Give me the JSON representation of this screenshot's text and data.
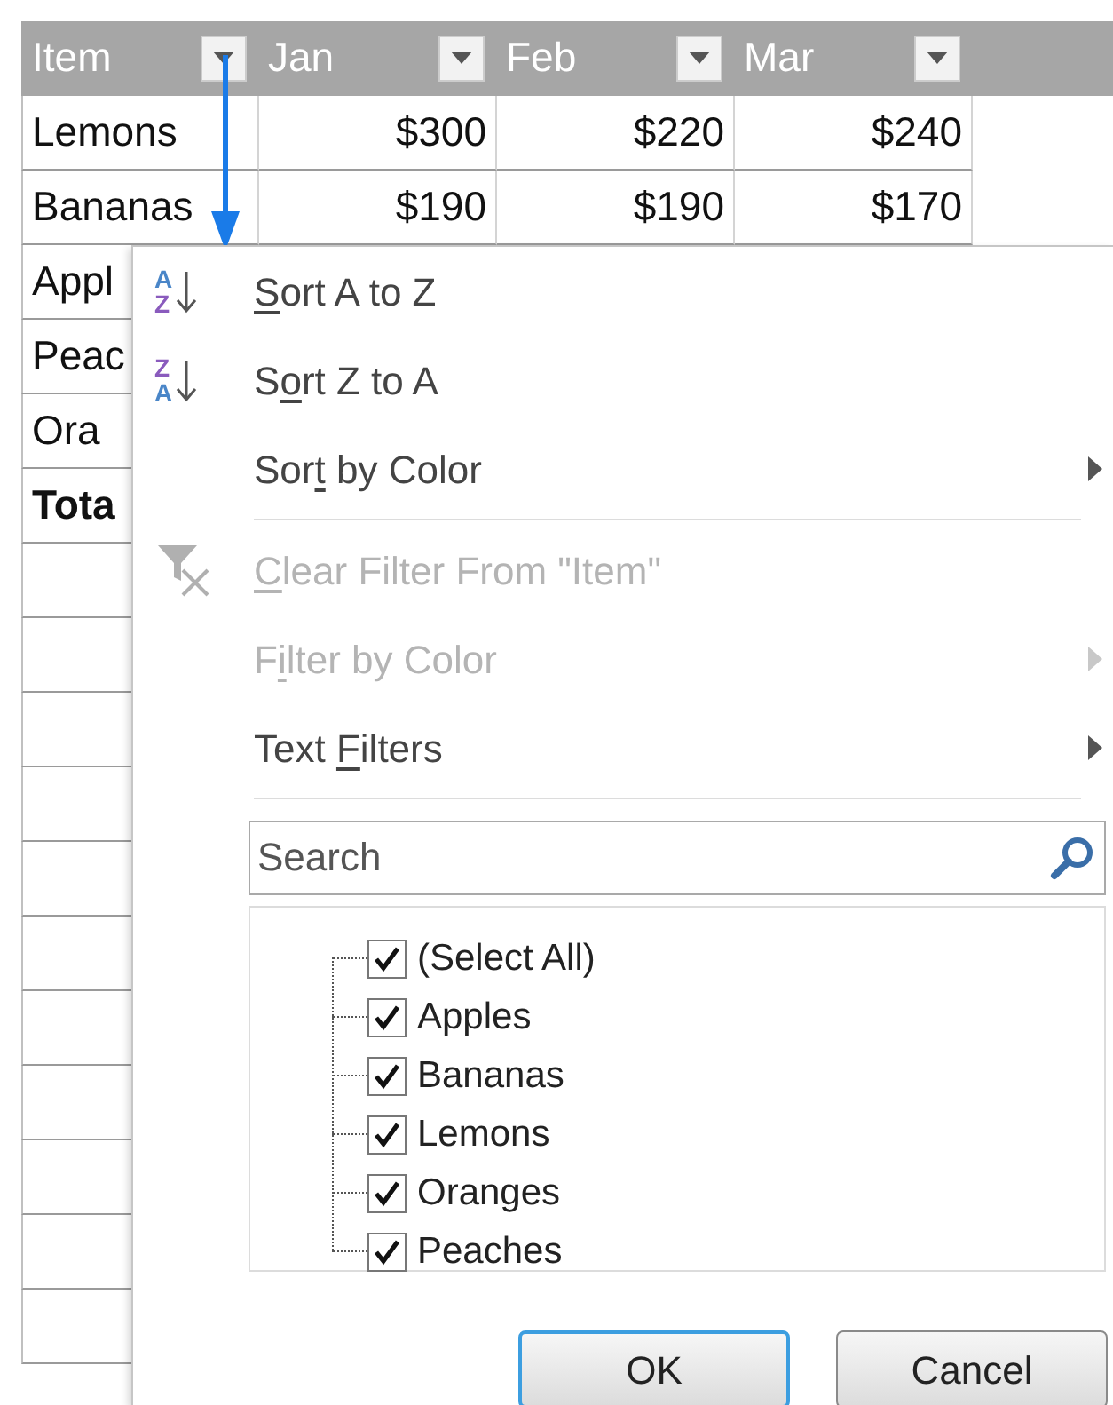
{
  "table": {
    "columns": [
      {
        "label": "Item"
      },
      {
        "label": "Jan"
      },
      {
        "label": "Feb"
      },
      {
        "label": "Mar"
      }
    ],
    "rows": [
      {
        "kind": "data",
        "cells": [
          "Lemons",
          "$300",
          "$220",
          "$240"
        ]
      },
      {
        "kind": "data",
        "cells": [
          "Bananas",
          "$190",
          "$190",
          "$170"
        ]
      },
      {
        "kind": "data",
        "cells": [
          "Appl"
        ]
      },
      {
        "kind": "data",
        "cells": [
          "Peac"
        ]
      },
      {
        "kind": "data",
        "cells": [
          "Ora"
        ]
      },
      {
        "kind": "total",
        "cells": [
          "Tota"
        ]
      }
    ]
  },
  "filter_menu": {
    "items": [
      {
        "kind": "command",
        "icon": {
          "kind": "sort",
          "top": "A",
          "bottom": "Z"
        },
        "key": "S",
        "after": "ort A to Z",
        "disabled": false,
        "submenu": false
      },
      {
        "kind": "command",
        "icon": {
          "kind": "sort",
          "top": "Z",
          "bottom": "A"
        },
        "before": "S",
        "key": "o",
        "after": "rt Z to A",
        "disabled": false,
        "submenu": false
      },
      {
        "kind": "command",
        "before": "Sor",
        "key": "t",
        "after": " by Color",
        "disabled": false,
        "submenu": true
      },
      {
        "kind": "separator"
      },
      {
        "kind": "command",
        "icon": {
          "kind": "clear_filter"
        },
        "key": "C",
        "after": "lear Filter From \"Item\"",
        "disabled": true,
        "submenu": false
      },
      {
        "kind": "command",
        "before": "F",
        "key": "i",
        "after": "lter by Color",
        "disabled": true,
        "submenu": true
      },
      {
        "kind": "command",
        "before": "Text ",
        "key": "F",
        "after": "ilters",
        "disabled": false,
        "submenu": true
      },
      {
        "kind": "separator"
      }
    ],
    "search": {
      "placeholder": "Search"
    },
    "values": [
      {
        "label": "(Select All)",
        "checked": true
      },
      {
        "label": "Apples",
        "checked": true
      },
      {
        "label": "Bananas",
        "checked": true
      },
      {
        "label": "Lemons",
        "checked": true
      },
      {
        "label": "Oranges",
        "checked": true
      },
      {
        "label": "Peaches",
        "checked": true
      }
    ],
    "buttons": [
      {
        "label": "OK",
        "default": true
      },
      {
        "label": "Cancel",
        "default": false
      }
    ]
  }
}
